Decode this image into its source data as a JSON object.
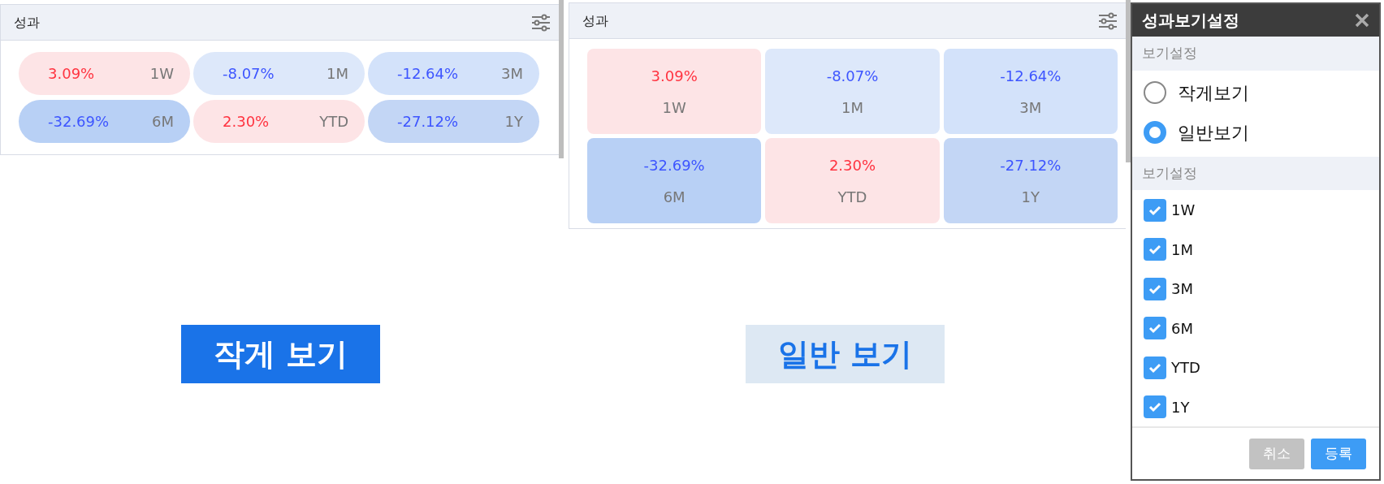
{
  "panels": [
    {
      "title": "성과",
      "kind": "compact",
      "tiles": [
        {
          "value": "3.09%",
          "period": "1W",
          "kind": "up",
          "color": "#fde4e6"
        },
        {
          "value": "-8.07%",
          "period": "1M",
          "kind": "down",
          "color": "#dde8fa"
        },
        {
          "value": "-12.64%",
          "period": "3M",
          "kind": "down",
          "color": "#d3e2fa"
        },
        {
          "value": "-32.69%",
          "period": "6M",
          "kind": "down",
          "color": "#b8d0f5"
        },
        {
          "value": "2.30%",
          "period": "YTD",
          "kind": "up",
          "color": "#fde4e6"
        },
        {
          "value": "-27.12%",
          "period": "1Y",
          "kind": "down",
          "color": "#c3d6f5"
        }
      ]
    },
    {
      "title": "성과",
      "kind": "normal",
      "tiles": [
        {
          "value": "3.09%",
          "period": "1W",
          "kind": "up",
          "color": "#fde4e6"
        },
        {
          "value": "-8.07%",
          "period": "1M",
          "kind": "down",
          "color": "#dde8fa"
        },
        {
          "value": "-12.64%",
          "period": "3M",
          "kind": "down",
          "color": "#d3e2fa"
        },
        {
          "value": "-32.69%",
          "period": "6M",
          "kind": "down",
          "color": "#b8d0f5"
        },
        {
          "value": "2.30%",
          "period": "YTD",
          "kind": "up",
          "color": "#fde4e6"
        },
        {
          "value": "-27.12%",
          "period": "1Y",
          "kind": "down",
          "color": "#c3d6f5"
        }
      ]
    }
  ],
  "captions": [
    {
      "text": "작게 보기",
      "kind": "filled"
    },
    {
      "text": "일반 보기",
      "kind": "light"
    }
  ],
  "dialog": {
    "title": "성과보기설정",
    "sections": [
      {
        "title": "보기설정",
        "kind": "radio",
        "options": [
          {
            "label": "작게보기",
            "selected": false
          },
          {
            "label": "일반보기",
            "selected": true
          }
        ]
      },
      {
        "title": "보기설정",
        "kind": "check",
        "options": [
          {
            "label": "1W",
            "checked": true
          },
          {
            "label": "1M",
            "checked": true
          },
          {
            "label": "3M",
            "checked": true
          },
          {
            "label": "6M",
            "checked": true
          },
          {
            "label": "YTD",
            "checked": true
          },
          {
            "label": "1Y",
            "checked": true
          }
        ]
      }
    ],
    "buttons": [
      {
        "label": "취소",
        "kind": "secondary"
      },
      {
        "label": "등록",
        "kind": "primary"
      }
    ]
  }
}
